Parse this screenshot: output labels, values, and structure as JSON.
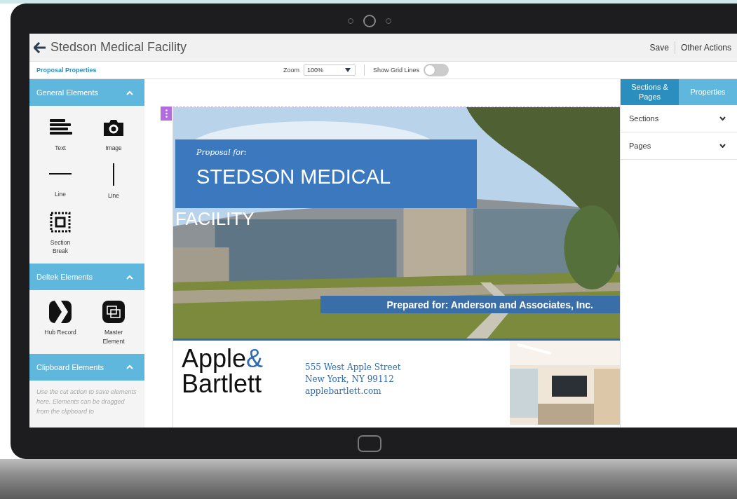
{
  "header": {
    "title": "Stedson Medical Facility",
    "actions": [
      "Save",
      "Other Actions"
    ]
  },
  "toolbar": {
    "link": "Proposal Properties",
    "zoom_label": "Zoom",
    "zoom_value": "100%",
    "grid_label": "Show Grid Lines",
    "grid_on": false
  },
  "sidebar": [
    {
      "title": "General Elements",
      "expanded": true,
      "items": [
        {
          "label": "Text",
          "kind": "text"
        },
        {
          "label": "Image",
          "kind": "camera"
        },
        {
          "label": "Line",
          "kind": "hline"
        },
        {
          "label": "Line",
          "kind": "vline"
        },
        {
          "label": "Section Break",
          "kind": "section"
        }
      ]
    },
    {
      "title": "Deltek Elements",
      "expanded": true,
      "items": [
        {
          "label": "Hub Record",
          "kind": "hub"
        },
        {
          "label": "Master Element",
          "kind": "master"
        }
      ]
    },
    {
      "title": "Clipboard Elements",
      "expanded": true,
      "note": "Use the cut action to save elements here. Elements can be dragged from the clipboard to"
    }
  ],
  "document": {
    "kicker": "Proposal for:",
    "title": "STEDSON MEDICAL",
    "title_overflow": "FACILITY",
    "prepared": "Prepared for: Anderson and Associates, Inc.",
    "logo": "Apple",
    "logo_amp": "&",
    "logo_second": "Bartlett",
    "address": [
      "555 West Apple Street",
      "New York, NY 99112",
      "applebartlett.com"
    ]
  },
  "right_panel": {
    "tabs": [
      {
        "label": "Sections & Pages",
        "selected": true
      },
      {
        "label": "Properties",
        "selected": false
      }
    ],
    "rows": [
      {
        "label": "Sections",
        "expanded": false
      },
      {
        "label": "Pages",
        "expanded": false
      }
    ]
  }
}
